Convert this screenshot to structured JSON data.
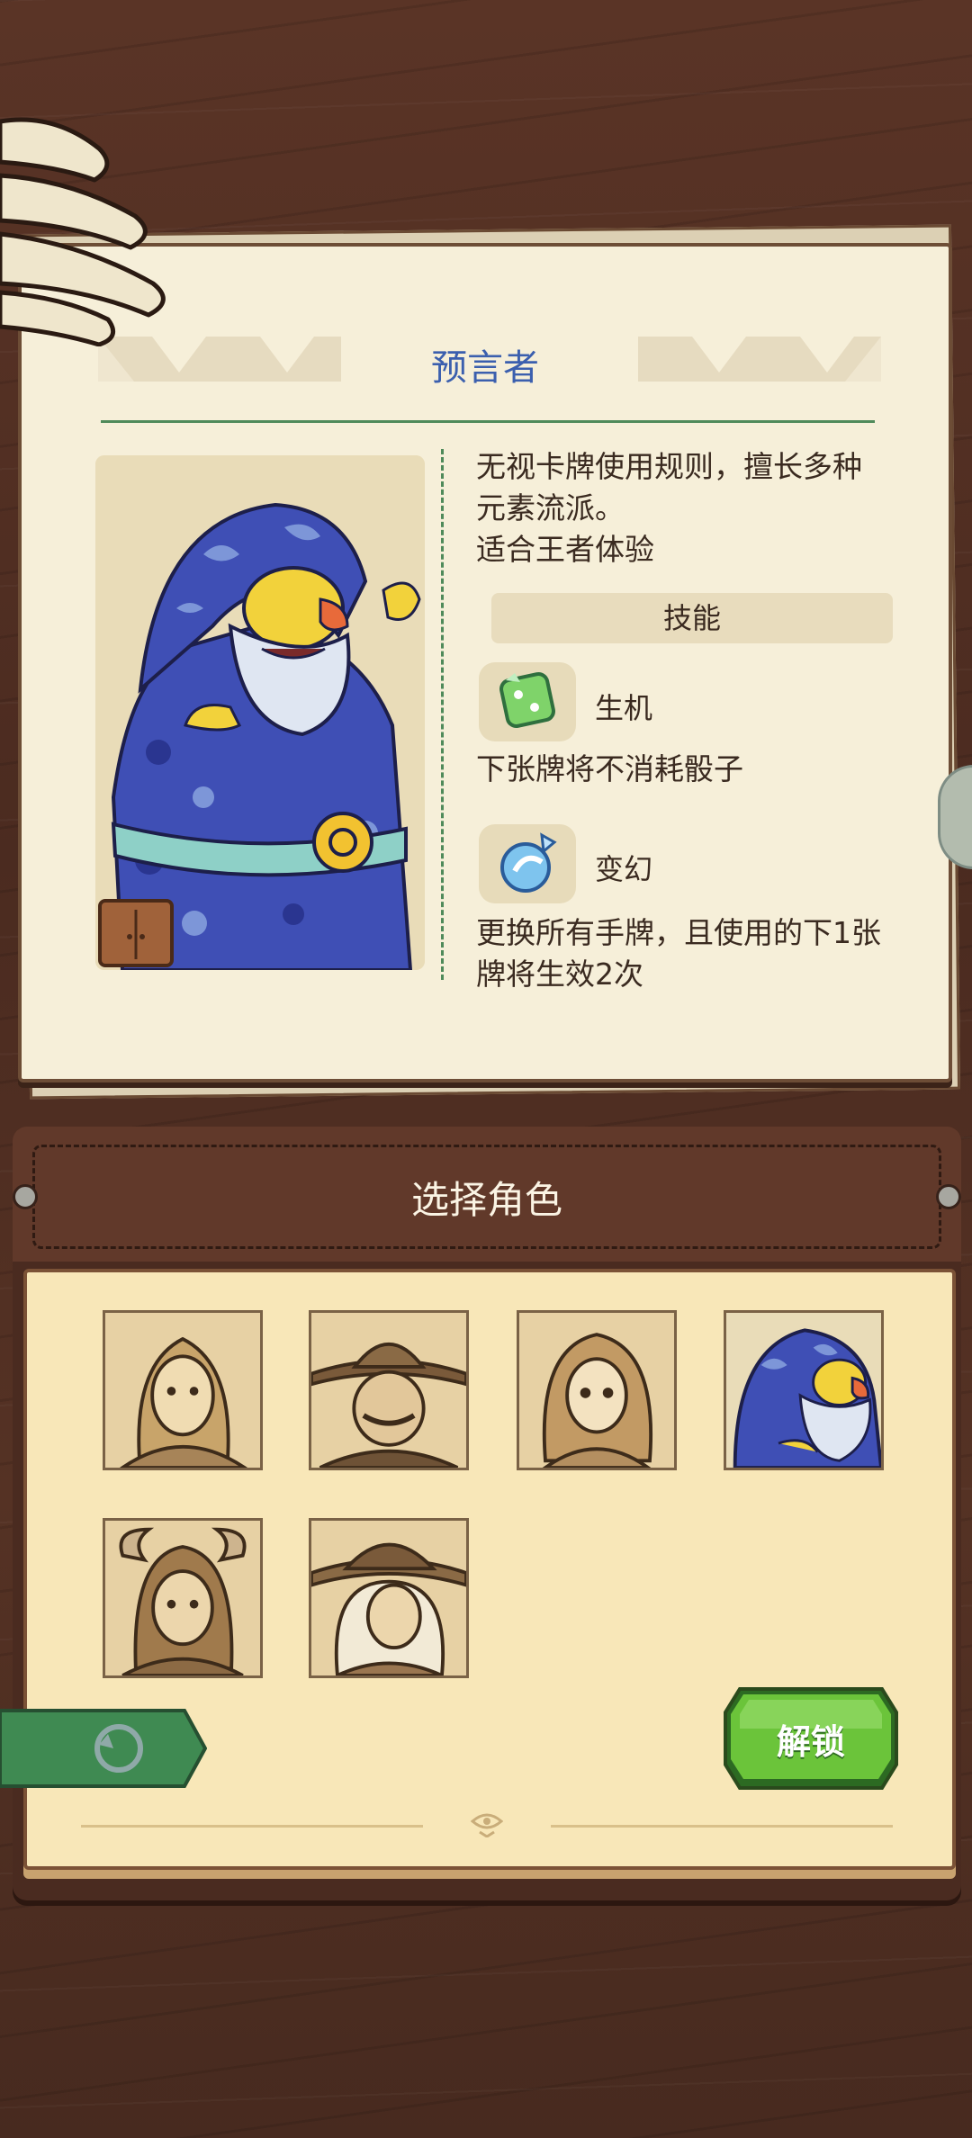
{
  "character": {
    "name": "预言者",
    "description_line1": "无视卡牌使用规则，擅长多种",
    "description_line2": "元素流派。",
    "description_line3": "适合王者体验",
    "skills_header": "技能",
    "skills": [
      {
        "name": "生机",
        "icon": "green-dice-icon",
        "desc_line1": "下张牌将不消耗骰子",
        "desc_line2": ""
      },
      {
        "name": "变幻",
        "icon": "blue-swirl-icon",
        "desc_line1": "更换所有手牌，且使用的下1张",
        "desc_line2": "牌将生效2次"
      }
    ]
  },
  "select_panel": {
    "title": "选择角色",
    "characters": [
      {
        "id": "curly-hair-man",
        "selected": false
      },
      {
        "id": "cowboy",
        "selected": false
      },
      {
        "id": "lady",
        "selected": false
      },
      {
        "id": "prophet",
        "selected": true
      },
      {
        "id": "horned-girl",
        "selected": false
      },
      {
        "id": "witch",
        "selected": false
      }
    ],
    "unlock_label": "解锁"
  },
  "colors": {
    "title_blue": "#3b5fae",
    "accent_green": "#4f8a5a",
    "unlock_green": "#6bc43a",
    "wood_dark": "#4e2e22"
  }
}
